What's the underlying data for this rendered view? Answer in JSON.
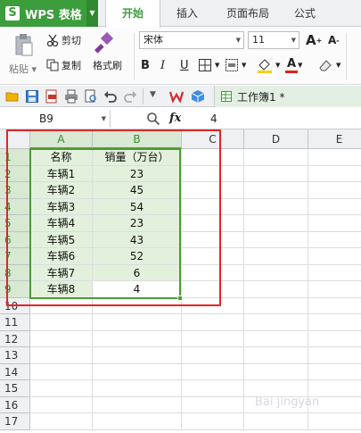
{
  "app": {
    "name": "WPS 表格",
    "logo_letter": "S"
  },
  "tabs": [
    {
      "label": "开始",
      "active": true
    },
    {
      "label": "插入",
      "active": false
    },
    {
      "label": "页面布局",
      "active": false
    },
    {
      "label": "公式",
      "active": false
    }
  ],
  "ribbon": {
    "cut": "剪切",
    "copy": "复制",
    "format_painter": "格式刷",
    "paste": "粘贴",
    "font_name": "宋体",
    "font_size": "11",
    "bold": "B",
    "italic": "I",
    "underline": "U",
    "font_color_letter": "A",
    "grow_font": "A",
    "shrink_font": "A"
  },
  "quick_access": {
    "document_title": "工作簿1 *"
  },
  "formula_bar": {
    "cell_ref": "B9",
    "fx": "fx",
    "value": "4"
  },
  "sheet": {
    "columns": [
      "A",
      "B",
      "C",
      "D",
      "E"
    ],
    "rows": [
      "1",
      "2",
      "3",
      "4",
      "5",
      "6",
      "7",
      "8",
      "9",
      "10",
      "11",
      "12",
      "13",
      "14",
      "15",
      "16",
      "17"
    ],
    "header": [
      "名称",
      "销量（万台）"
    ],
    "data": [
      [
        "车辆1",
        "23"
      ],
      [
        "车辆2",
        "45"
      ],
      [
        "车辆3",
        "54"
      ],
      [
        "车辆4",
        "23"
      ],
      [
        "车辆5",
        "43"
      ],
      [
        "车辆6",
        "52"
      ],
      [
        "车辆7",
        "6"
      ],
      [
        "车辆8",
        "4"
      ]
    ]
  },
  "colors": {
    "accent": "#3b9d3b",
    "selection": "#e3f1dc",
    "highlight_box": "#e0262a"
  },
  "watermark": "Bai  jingyan"
}
